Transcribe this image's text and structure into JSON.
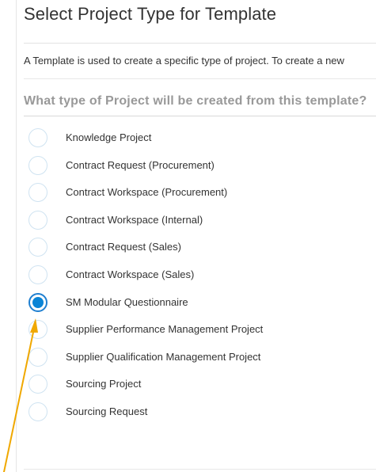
{
  "header": {
    "title": "Select Project Type for Template"
  },
  "description": "A Template is used to create a specific type of project. To create a new",
  "question": "What type of Project will be created from this template?",
  "options": [
    {
      "label": "Knowledge Project",
      "selected": false
    },
    {
      "label": "Contract Request (Procurement)",
      "selected": false
    },
    {
      "label": "Contract Workspace (Procurement)",
      "selected": false
    },
    {
      "label": "Contract Workspace (Internal)",
      "selected": false
    },
    {
      "label": "Contract Request (Sales)",
      "selected": false
    },
    {
      "label": "Contract Workspace (Sales)",
      "selected": false
    },
    {
      "label": "SM Modular Questionnaire",
      "selected": true
    },
    {
      "label": "Supplier Performance Management Project",
      "selected": false
    },
    {
      "label": "Supplier Qualification Management Project",
      "selected": false
    },
    {
      "label": "Sourcing Project",
      "selected": false
    },
    {
      "label": "Sourcing Request",
      "selected": false
    }
  ],
  "colors": {
    "accent": "#0a84d6",
    "radio_border": "#cfe3f1",
    "annotation_arrow": "#f0a800"
  }
}
